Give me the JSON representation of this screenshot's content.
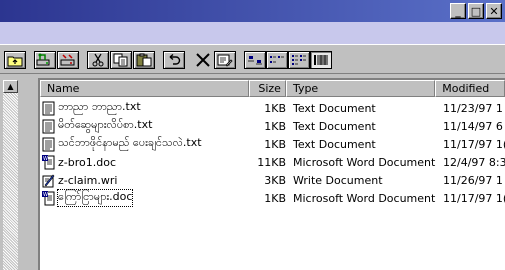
{
  "window": {
    "controls": {
      "minimize": "_",
      "maximize": "□",
      "close": "✕"
    }
  },
  "toolbar": {
    "buttons": [
      {
        "name": "up-folder-icon"
      },
      {
        "name": "map-drive-icon"
      },
      {
        "name": "disconnect-drive-icon"
      },
      {
        "name": "cut-icon"
      },
      {
        "name": "copy-icon"
      },
      {
        "name": "paste-icon"
      },
      {
        "name": "undo-icon"
      },
      {
        "name": "delete-icon"
      },
      {
        "name": "properties-icon"
      },
      {
        "name": "large-icons-view-icon"
      },
      {
        "name": "small-icons-view-icon"
      },
      {
        "name": "list-view-icon"
      },
      {
        "name": "details-view-icon"
      }
    ]
  },
  "list": {
    "columns": {
      "name": "Name",
      "size": "Size",
      "type": "Type",
      "modified": "Modified"
    },
    "files": [
      {
        "name": "ဘာညာ ဘာညာ.txt",
        "size": "1KB",
        "type": "Text Document",
        "modified": "11/23/97 1",
        "icon": "text-file-icon"
      },
      {
        "name": "မိတ်ဆွေများလိပ်စာ.txt",
        "size": "1KB",
        "type": "Text Document",
        "modified": "11/14/97 6",
        "icon": "text-file-icon"
      },
      {
        "name": "သင်ဘာဖိုင်နာမည် ပေးချင်သလဲ.txt",
        "size": "1KB",
        "type": "Text Document",
        "modified": "11/17/97 1(",
        "icon": "text-file-icon"
      },
      {
        "name": "z-bro1.doc",
        "size": "11KB",
        "type": "Microsoft Word Document",
        "modified": "12/4/97 8:3",
        "icon": "word-doc-icon"
      },
      {
        "name": "z-claim.wri",
        "size": "3KB",
        "type": "Write Document",
        "modified": "11/26/97 1",
        "icon": "write-doc-icon"
      },
      {
        "name": "ကြော်ငြာများ.doc",
        "size": "1KB",
        "type": "Microsoft Word Document",
        "modified": "11/17/97 1(",
        "icon": "word-doc-icon"
      }
    ]
  },
  "colors": {
    "titlebar_start": "#2c3590",
    "titlebar_end": "#5a70c8",
    "menubar": "#c8c8ec",
    "face": "#c0c0c0"
  }
}
